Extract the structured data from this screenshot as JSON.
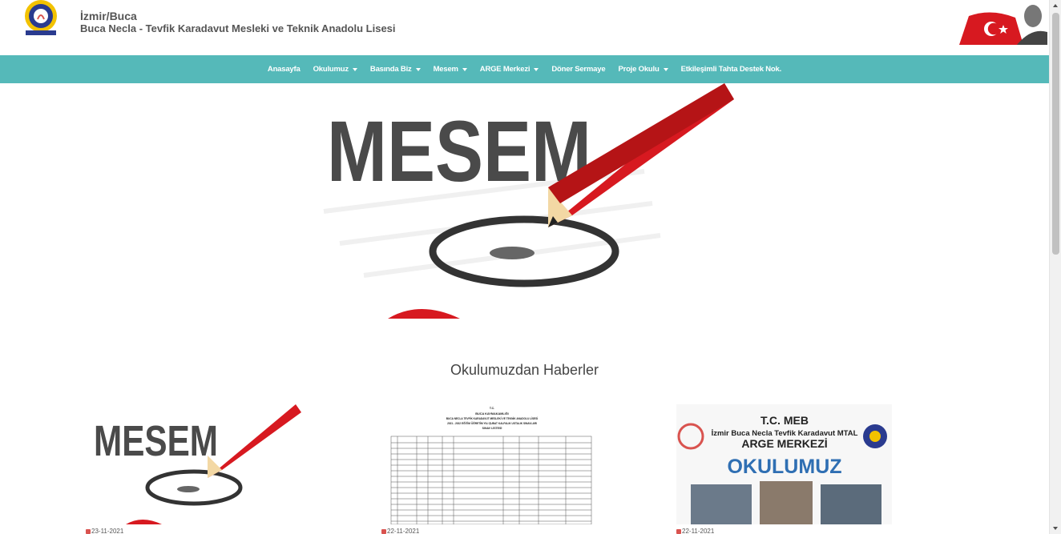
{
  "header": {
    "city": "İzmir/Buca",
    "school_name": "Buca Necla - Tevfik Karadavut Mesleki ve Teknik Anadolu Lisesi"
  },
  "nav": {
    "items": [
      {
        "label": "Anasayfa",
        "dropdown": false
      },
      {
        "label": "Okulumuz",
        "dropdown": true
      },
      {
        "label": "Basında Biz",
        "dropdown": true
      },
      {
        "label": "Mesem",
        "dropdown": true
      },
      {
        "label": "ARGE Merkezi",
        "dropdown": true
      },
      {
        "label": "Döner Sermaye",
        "dropdown": false
      },
      {
        "label": "Proje Okulu",
        "dropdown": true
      },
      {
        "label": "Etkileşimli Tahta Destek Nok.",
        "dropdown": false
      }
    ]
  },
  "hero": {
    "text": "MESEM"
  },
  "news": {
    "section_title": "Okulumuzdan Haberler",
    "cards": [
      {
        "image_text": "MESEM",
        "date": "23-11-2021"
      },
      {
        "doc_lines": [
          "T.C.",
          "BUCA KAYMAKAMLIĞI",
          "BUCA NECLA TEVFİK KARADAVUT MESLEKİ VE TEKNİK ANADOLU LİSESİ",
          "2021 - 2022 EĞİTİM ÖĞRETİM YILI ŞUBAT KALFALIK USTALIK SINAVLARI",
          "SINAV LİSTESİ"
        ],
        "date": "22-11-2021"
      },
      {
        "lines": [
          "T.C. MEB",
          "İzmir Buca Necla Tevfik Karadavut MTAL",
          "ARGE MERKEZİ",
          "OKULUMUZ"
        ],
        "date": "22-11-2021"
      }
    ]
  },
  "colors": {
    "nav_bg": "#55b9b9",
    "accent_red": "#d9534f"
  }
}
